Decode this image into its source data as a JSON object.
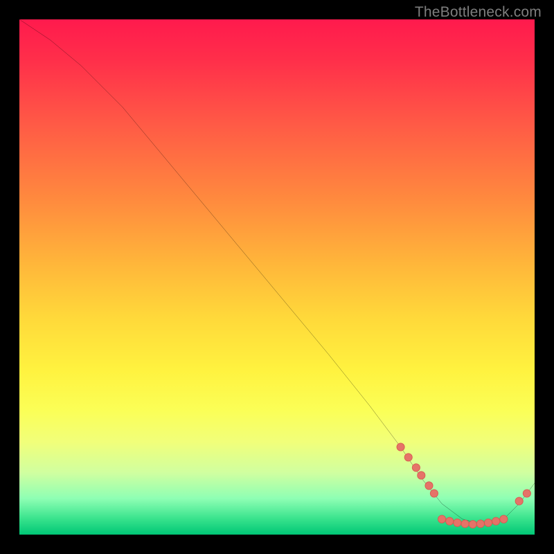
{
  "watermark": "TheBottleneck.com",
  "colors": {
    "background": "#000000",
    "line": "#000000",
    "point_fill": "#e57368",
    "point_stroke": "#d85a50",
    "gradient_top": "#ff1a4d",
    "gradient_bottom": "#00c776"
  },
  "chart_data": {
    "type": "line",
    "title": "",
    "xlabel": "",
    "ylabel": "",
    "xlim": [
      0,
      100
    ],
    "ylim": [
      0,
      100
    ],
    "grid": false,
    "legend": false,
    "series": [
      {
        "name": "curve",
        "style": "line",
        "x": [
          0,
          6,
          12,
          20,
          30,
          40,
          50,
          60,
          68,
          74,
          78,
          82,
          86,
          90,
          94,
          97,
          100
        ],
        "y": [
          100,
          96,
          91,
          83,
          71,
          59,
          47,
          35,
          25,
          17,
          11,
          6,
          3,
          2,
          3,
          6,
          10
        ]
      },
      {
        "name": "marks-descending",
        "style": "points",
        "x": [
          74,
          75.5,
          77,
          78,
          79.5,
          80.5
        ],
        "y": [
          17,
          15,
          13,
          11.5,
          9.5,
          8
        ]
      },
      {
        "name": "marks-trough",
        "style": "points",
        "x": [
          82,
          83.5,
          85,
          86.5,
          88,
          89.5,
          91,
          92.5,
          94
        ],
        "y": [
          3,
          2.6,
          2.3,
          2.1,
          2,
          2.1,
          2.3,
          2.6,
          3
        ]
      },
      {
        "name": "marks-rising",
        "style": "points",
        "x": [
          97,
          98.5
        ],
        "y": [
          6.5,
          8
        ]
      }
    ]
  }
}
